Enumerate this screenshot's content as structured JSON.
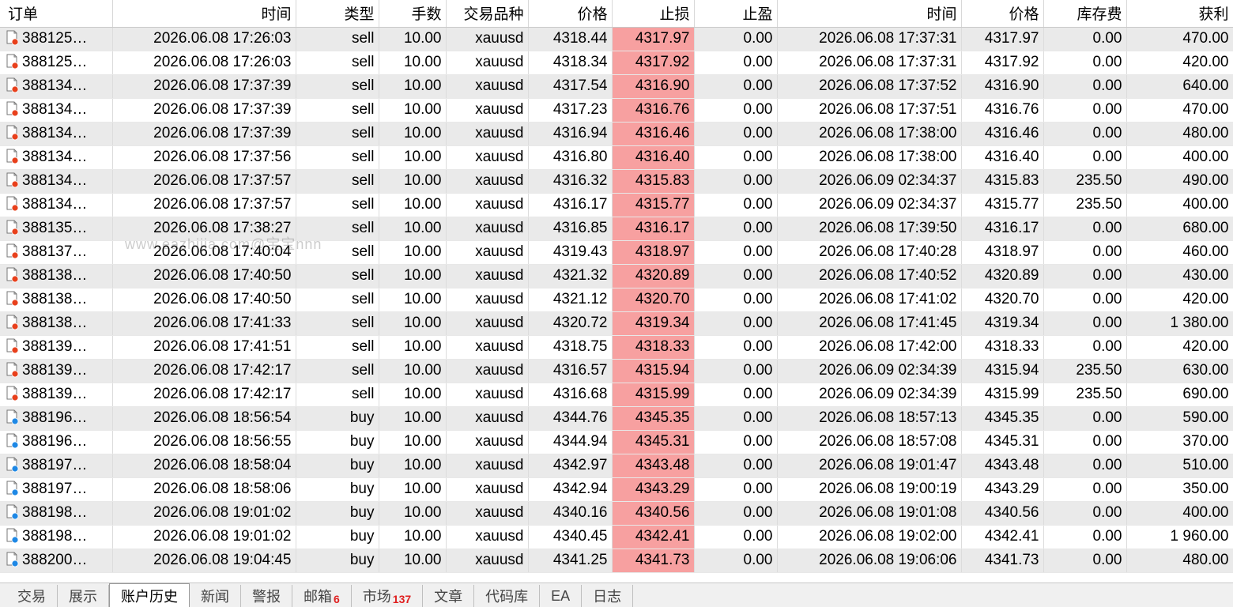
{
  "headers": [
    "订单",
    "时间",
    "类型",
    "手数",
    "交易品种",
    "价格",
    "止损",
    "止盈",
    "时间",
    "价格",
    "库存费",
    "获利"
  ],
  "rows": [
    {
      "order": "388125…",
      "open_time": "2026.06.08 17:26:03",
      "type": "sell",
      "lots": "10.00",
      "symbol": "xauusd",
      "price": "4318.44",
      "sl": "4317.97",
      "tp": "0.00",
      "close_time": "2026.06.08 17:37:31",
      "close_price": "4317.97",
      "swap": "0.00",
      "profit": "470.00"
    },
    {
      "order": "388125…",
      "open_time": "2026.06.08 17:26:03",
      "type": "sell",
      "lots": "10.00",
      "symbol": "xauusd",
      "price": "4318.34",
      "sl": "4317.92",
      "tp": "0.00",
      "close_time": "2026.06.08 17:37:31",
      "close_price": "4317.92",
      "swap": "0.00",
      "profit": "420.00"
    },
    {
      "order": "388134…",
      "open_time": "2026.06.08 17:37:39",
      "type": "sell",
      "lots": "10.00",
      "symbol": "xauusd",
      "price": "4317.54",
      "sl": "4316.90",
      "tp": "0.00",
      "close_time": "2026.06.08 17:37:52",
      "close_price": "4316.90",
      "swap": "0.00",
      "profit": "640.00"
    },
    {
      "order": "388134…",
      "open_time": "2026.06.08 17:37:39",
      "type": "sell",
      "lots": "10.00",
      "symbol": "xauusd",
      "price": "4317.23",
      "sl": "4316.76",
      "tp": "0.00",
      "close_time": "2026.06.08 17:37:51",
      "close_price": "4316.76",
      "swap": "0.00",
      "profit": "470.00"
    },
    {
      "order": "388134…",
      "open_time": "2026.06.08 17:37:39",
      "type": "sell",
      "lots": "10.00",
      "symbol": "xauusd",
      "price": "4316.94",
      "sl": "4316.46",
      "tp": "0.00",
      "close_time": "2026.06.08 17:38:00",
      "close_price": "4316.46",
      "swap": "0.00",
      "profit": "480.00"
    },
    {
      "order": "388134…",
      "open_time": "2026.06.08 17:37:56",
      "type": "sell",
      "lots": "10.00",
      "symbol": "xauusd",
      "price": "4316.80",
      "sl": "4316.40",
      "tp": "0.00",
      "close_time": "2026.06.08 17:38:00",
      "close_price": "4316.40",
      "swap": "0.00",
      "profit": "400.00"
    },
    {
      "order": "388134…",
      "open_time": "2026.06.08 17:37:57",
      "type": "sell",
      "lots": "10.00",
      "symbol": "xauusd",
      "price": "4316.32",
      "sl": "4315.83",
      "tp": "0.00",
      "close_time": "2026.06.09 02:34:37",
      "close_price": "4315.83",
      "swap": "235.50",
      "profit": "490.00"
    },
    {
      "order": "388134…",
      "open_time": "2026.06.08 17:37:57",
      "type": "sell",
      "lots": "10.00",
      "symbol": "xauusd",
      "price": "4316.17",
      "sl": "4315.77",
      "tp": "0.00",
      "close_time": "2026.06.09 02:34:37",
      "close_price": "4315.77",
      "swap": "235.50",
      "profit": "400.00"
    },
    {
      "order": "388135…",
      "open_time": "2026.06.08 17:38:27",
      "type": "sell",
      "lots": "10.00",
      "symbol": "xauusd",
      "price": "4316.85",
      "sl": "4316.17",
      "tp": "0.00",
      "close_time": "2026.06.08 17:39:50",
      "close_price": "4316.17",
      "swap": "0.00",
      "profit": "680.00"
    },
    {
      "order": "388137…",
      "open_time": "2026.06.08 17:40:04",
      "type": "sell",
      "lots": "10.00",
      "symbol": "xauusd",
      "price": "4319.43",
      "sl": "4318.97",
      "tp": "0.00",
      "close_time": "2026.06.08 17:40:28",
      "close_price": "4318.97",
      "swap": "0.00",
      "profit": "460.00"
    },
    {
      "order": "388138…",
      "open_time": "2026.06.08 17:40:50",
      "type": "sell",
      "lots": "10.00",
      "symbol": "xauusd",
      "price": "4321.32",
      "sl": "4320.89",
      "tp": "0.00",
      "close_time": "2026.06.08 17:40:52",
      "close_price": "4320.89",
      "swap": "0.00",
      "profit": "430.00"
    },
    {
      "order": "388138…",
      "open_time": "2026.06.08 17:40:50",
      "type": "sell",
      "lots": "10.00",
      "symbol": "xauusd",
      "price": "4321.12",
      "sl": "4320.70",
      "tp": "0.00",
      "close_time": "2026.06.08 17:41:02",
      "close_price": "4320.70",
      "swap": "0.00",
      "profit": "420.00"
    },
    {
      "order": "388138…",
      "open_time": "2026.06.08 17:41:33",
      "type": "sell",
      "lots": "10.00",
      "symbol": "xauusd",
      "price": "4320.72",
      "sl": "4319.34",
      "tp": "0.00",
      "close_time": "2026.06.08 17:41:45",
      "close_price": "4319.34",
      "swap": "0.00",
      "profit": "1 380.00"
    },
    {
      "order": "388139…",
      "open_time": "2026.06.08 17:41:51",
      "type": "sell",
      "lots": "10.00",
      "symbol": "xauusd",
      "price": "4318.75",
      "sl": "4318.33",
      "tp": "0.00",
      "close_time": "2026.06.08 17:42:00",
      "close_price": "4318.33",
      "swap": "0.00",
      "profit": "420.00"
    },
    {
      "order": "388139…",
      "open_time": "2026.06.08 17:42:17",
      "type": "sell",
      "lots": "10.00",
      "symbol": "xauusd",
      "price": "4316.57",
      "sl": "4315.94",
      "tp": "0.00",
      "close_time": "2026.06.09 02:34:39",
      "close_price": "4315.94",
      "swap": "235.50",
      "profit": "630.00"
    },
    {
      "order": "388139…",
      "open_time": "2026.06.08 17:42:17",
      "type": "sell",
      "lots": "10.00",
      "symbol": "xauusd",
      "price": "4316.68",
      "sl": "4315.99",
      "tp": "0.00",
      "close_time": "2026.06.09 02:34:39",
      "close_price": "4315.99",
      "swap": "235.50",
      "profit": "690.00"
    },
    {
      "order": "388196…",
      "open_time": "2026.06.08 18:56:54",
      "type": "buy",
      "lots": "10.00",
      "symbol": "xauusd",
      "price": "4344.76",
      "sl": "4345.35",
      "tp": "0.00",
      "close_time": "2026.06.08 18:57:13",
      "close_price": "4345.35",
      "swap": "0.00",
      "profit": "590.00"
    },
    {
      "order": "388196…",
      "open_time": "2026.06.08 18:56:55",
      "type": "buy",
      "lots": "10.00",
      "symbol": "xauusd",
      "price": "4344.94",
      "sl": "4345.31",
      "tp": "0.00",
      "close_time": "2026.06.08 18:57:08",
      "close_price": "4345.31",
      "swap": "0.00",
      "profit": "370.00"
    },
    {
      "order": "388197…",
      "open_time": "2026.06.08 18:58:04",
      "type": "buy",
      "lots": "10.00",
      "symbol": "xauusd",
      "price": "4342.97",
      "sl": "4343.48",
      "tp": "0.00",
      "close_time": "2026.06.08 19:01:47",
      "close_price": "4343.48",
      "swap": "0.00",
      "profit": "510.00"
    },
    {
      "order": "388197…",
      "open_time": "2026.06.08 18:58:06",
      "type": "buy",
      "lots": "10.00",
      "symbol": "xauusd",
      "price": "4342.94",
      "sl": "4343.29",
      "tp": "0.00",
      "close_time": "2026.06.08 19:00:19",
      "close_price": "4343.29",
      "swap": "0.00",
      "profit": "350.00"
    },
    {
      "order": "388198…",
      "open_time": "2026.06.08 19:01:02",
      "type": "buy",
      "lots": "10.00",
      "symbol": "xauusd",
      "price": "4340.16",
      "sl": "4340.56",
      "tp": "0.00",
      "close_time": "2026.06.08 19:01:08",
      "close_price": "4340.56",
      "swap": "0.00",
      "profit": "400.00"
    },
    {
      "order": "388198…",
      "open_time": "2026.06.08 19:01:02",
      "type": "buy",
      "lots": "10.00",
      "symbol": "xauusd",
      "price": "4340.45",
      "sl": "4342.41",
      "tp": "0.00",
      "close_time": "2026.06.08 19:02:00",
      "close_price": "4342.41",
      "swap": "0.00",
      "profit": "1 960.00"
    },
    {
      "order": "388200…",
      "open_time": "2026.06.08 19:04:45",
      "type": "buy",
      "lots": "10.00",
      "symbol": "xauusd",
      "price": "4341.25",
      "sl": "4341.73",
      "tp": "0.00",
      "close_time": "2026.06.08 19:06:06",
      "close_price": "4341.73",
      "swap": "0.00",
      "profit": "480.00"
    }
  ],
  "icons": {
    "sell": "sell-order-icon",
    "buy": "buy-order-icon"
  },
  "colors": {
    "sell_dot": "#e8401c",
    "buy_dot": "#1e88e5",
    "stop_loss_bg": "#f7a0a0",
    "row_alt": "#eaeaea"
  },
  "watermark": "www.eazhijia.com@宝宝nnn",
  "tabs": [
    {
      "label": "交易",
      "active": false
    },
    {
      "label": "展示",
      "active": false
    },
    {
      "label": "账户历史",
      "active": true
    },
    {
      "label": "新闻",
      "active": false
    },
    {
      "label": "警报",
      "active": false
    },
    {
      "label": "邮箱",
      "badge": "6",
      "active": false
    },
    {
      "label": "市场",
      "badge": "137",
      "active": false
    },
    {
      "label": "文章",
      "active": false
    },
    {
      "label": "代码库",
      "active": false
    },
    {
      "label": "EA",
      "active": false
    },
    {
      "label": "日志",
      "active": false
    }
  ]
}
